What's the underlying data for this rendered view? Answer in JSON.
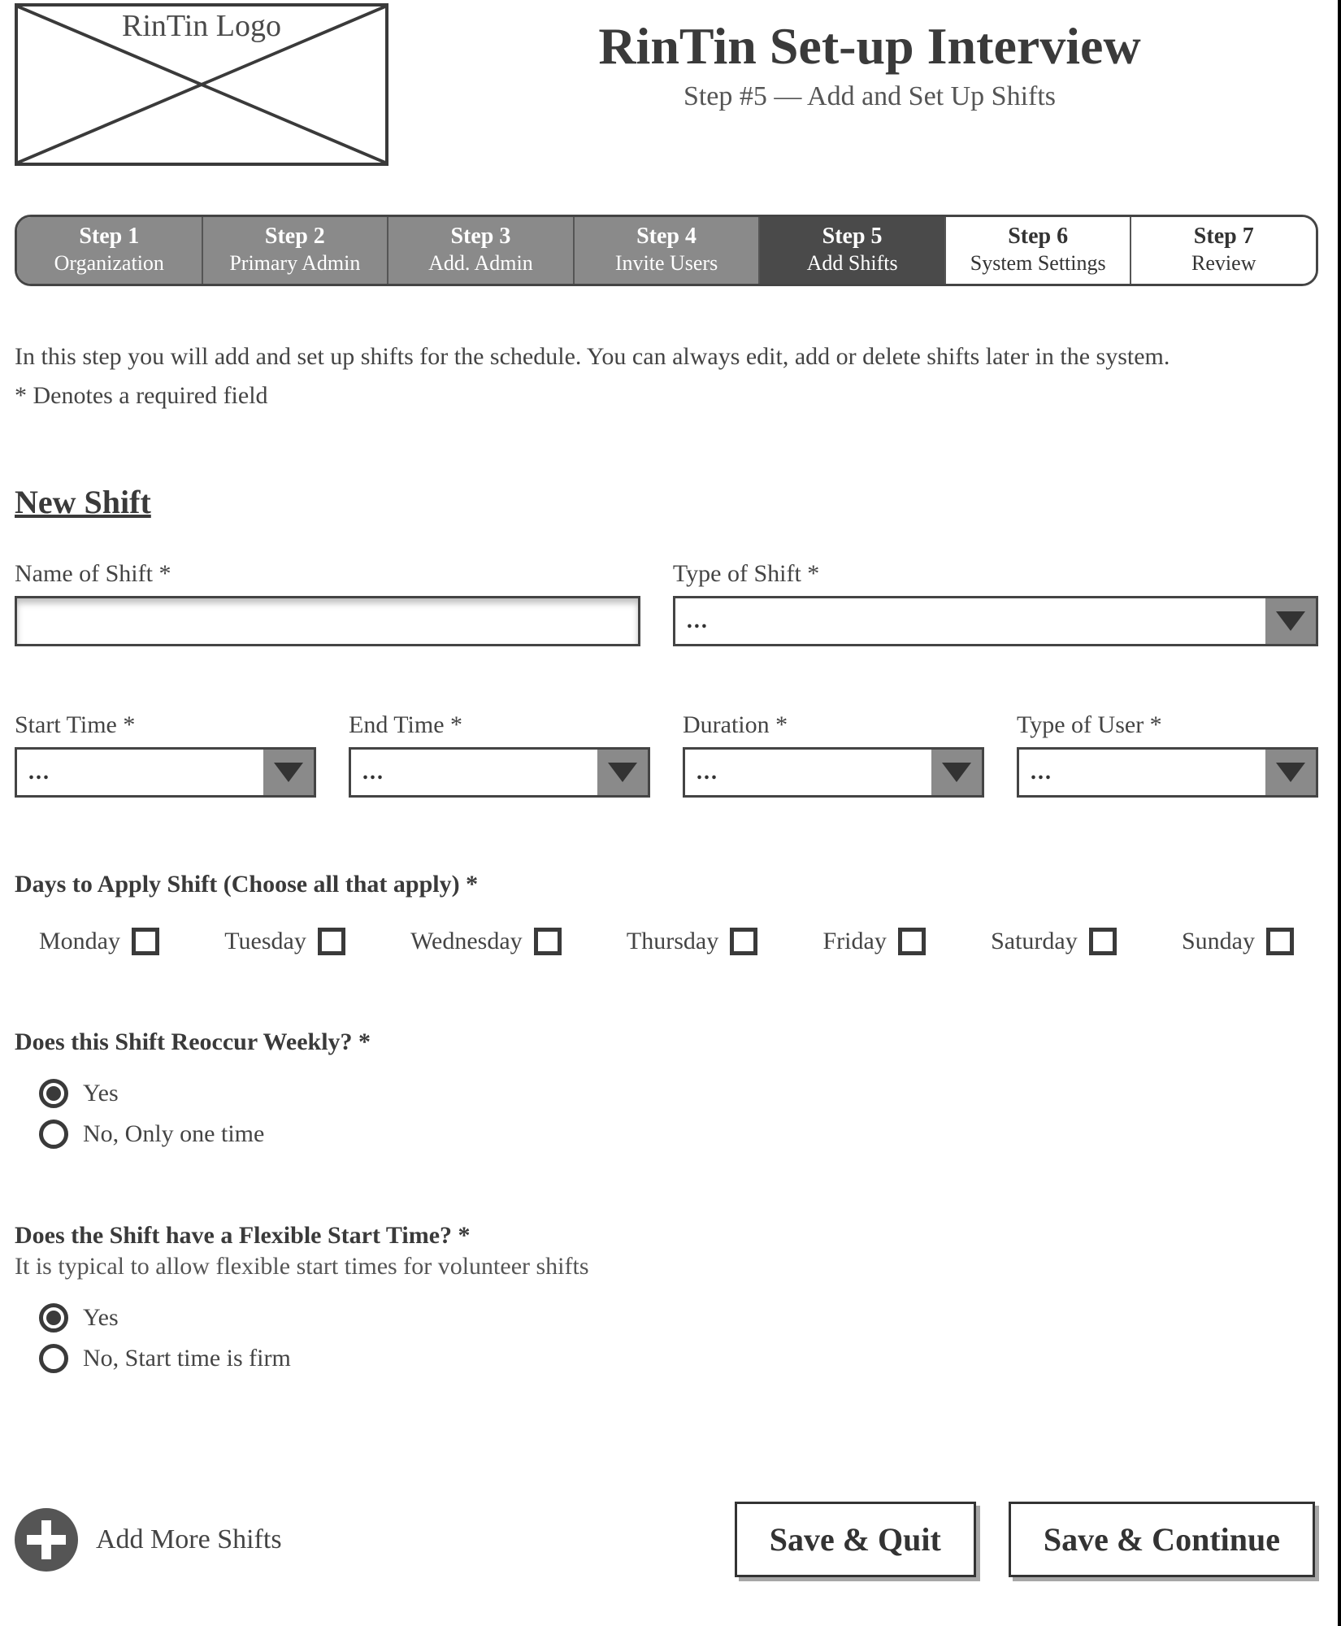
{
  "header": {
    "logo_text": "RinTin Logo",
    "title": "RinTin Set-up Interview",
    "subtitle": "Step #5 — Add and Set Up Shifts"
  },
  "steps": [
    {
      "title": "Step 1",
      "sub": "Organization",
      "state": "past"
    },
    {
      "title": "Step 2",
      "sub": "Primary Admin",
      "state": "past"
    },
    {
      "title": "Step 3",
      "sub": "Add. Admin",
      "state": "past"
    },
    {
      "title": "Step 4",
      "sub": "Invite Users",
      "state": "past"
    },
    {
      "title": "Step 5",
      "sub": "Add Shifts",
      "state": "active"
    },
    {
      "title": "Step 6",
      "sub": "System Settings",
      "state": "future"
    },
    {
      "title": "Step 7",
      "sub": "Review",
      "state": "future"
    }
  ],
  "intro": "In this step you will add and set up shifts for the schedule. You can always edit, add or delete shifts later in the system.",
  "required_note": "* Denotes a required field",
  "section_title": "New Shift",
  "fields": {
    "name_label": "Name of Shift *",
    "type_label": "Type of Shift *",
    "type_value": "...",
    "start_label": "Start Time *",
    "start_value": "...",
    "end_label": "End Time *",
    "end_value": "...",
    "duration_label": "Duration *",
    "duration_value": "...",
    "user_type_label": "Type of User *",
    "user_type_value": "..."
  },
  "days": {
    "label": "Days to Apply Shift (Choose all that apply) *",
    "items": [
      "Monday",
      "Tuesday",
      "Wednesday",
      "Thursday",
      "Friday",
      "Saturday",
      "Sunday"
    ]
  },
  "reoccur": {
    "label": "Does this Shift Reoccur Weekly? *",
    "yes": "Yes",
    "no": "No,  Only one time",
    "selected": "yes"
  },
  "flexible": {
    "label": "Does the Shift have a Flexible Start Time? *",
    "sub": "It is typical to allow flexible start times for volunteer shifts",
    "yes": "Yes",
    "no": "No, Start time is firm",
    "selected": "yes"
  },
  "footer": {
    "add_more": "Add More Shifts",
    "save_quit": "Save & Quit",
    "save_continue": "Save & Continue"
  }
}
